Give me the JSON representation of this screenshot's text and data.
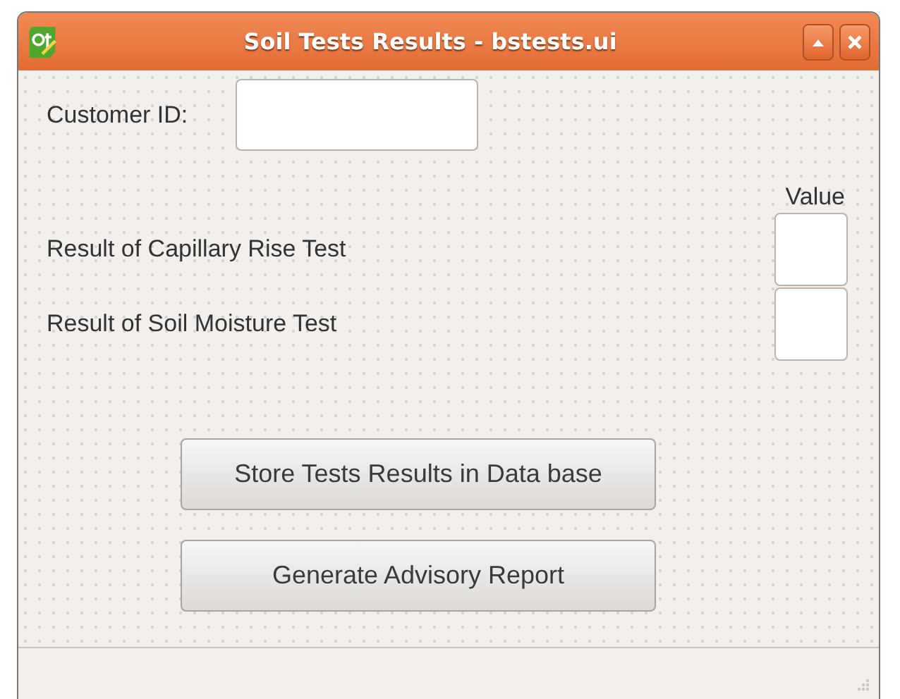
{
  "window": {
    "title": "Soil Tests Results - bstests.ui"
  },
  "customer_id": {
    "label": "Customer ID:"
  },
  "value_header": "Value",
  "tests": [
    {
      "label": "Result of Capillary Rise Test"
    },
    {
      "label": "Result of Soil Moisture Test"
    }
  ],
  "buttons": [
    "Store Tests Results in Data base",
    "Generate Advisory Report"
  ]
}
